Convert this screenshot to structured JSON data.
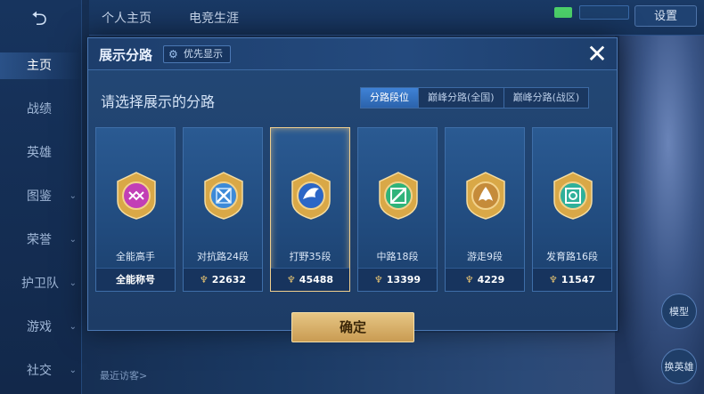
{
  "nav": {
    "items": [
      {
        "label": "主页",
        "active": true
      },
      {
        "label": "战绩"
      },
      {
        "label": "英雄"
      },
      {
        "label": "图鉴"
      },
      {
        "label": "荣誉"
      },
      {
        "label": "护卫队"
      },
      {
        "label": "游戏"
      },
      {
        "label": "社交"
      }
    ]
  },
  "top_tabs": [
    "个人主页",
    "电竞生涯"
  ],
  "settings_label": "设置",
  "right_buttons": [
    "模型",
    "换英雄"
  ],
  "bottom": {
    "recent_visitors": "最近访客>"
  },
  "modal": {
    "title": "展示分路",
    "priority_chip": "优先显示",
    "subtitle": "请选择展示的分路",
    "filter_tabs": [
      {
        "label": "分路段位",
        "active": true
      },
      {
        "label": "巅峰分路(全国)"
      },
      {
        "label": "巅峰分路(战区)"
      }
    ],
    "lanes": [
      {
        "name": "全能高手",
        "footer": "全能称号",
        "badge_color": "#c23fb6",
        "selected": false
      },
      {
        "name": "对抗路24段",
        "value": "22632",
        "badge_color": "#3d8ad8",
        "selected": false
      },
      {
        "name": "打野35段",
        "value": "45488",
        "badge_color": "#2b66c6",
        "selected": true
      },
      {
        "name": "中路18段",
        "value": "13399",
        "badge_color": "#2fb37a",
        "selected": false
      },
      {
        "name": "游走9段",
        "value": "4229",
        "badge_color": "#c58b3a",
        "selected": false
      },
      {
        "name": "发育路16段",
        "value": "11547",
        "badge_color": "#2fb09a",
        "selected": false
      }
    ],
    "confirm_label": "确定"
  },
  "colors": {
    "accent_gold": "#e6c684",
    "modal_bg": "#234876",
    "selected_border": "#f0cf8e"
  }
}
